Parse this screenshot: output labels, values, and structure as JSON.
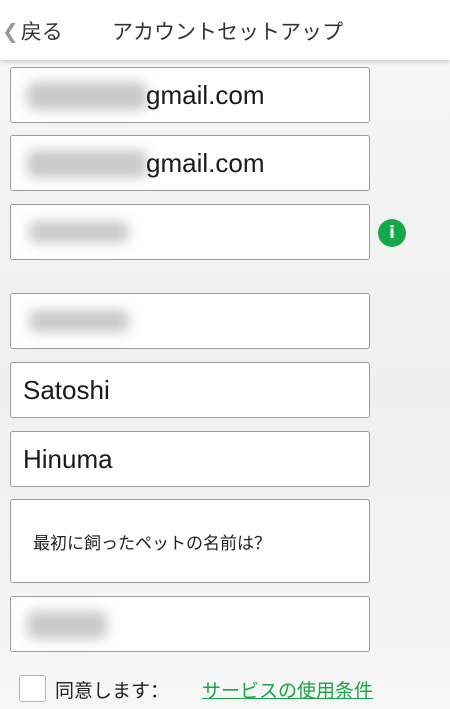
{
  "header": {
    "back_label": "戻る",
    "title": "アカウントセットアップ"
  },
  "form": {
    "email": "gmail.com",
    "email_confirm": "gmail.com",
    "first_name": "Satoshi",
    "last_name": "Hinuma",
    "security_question": "最初に飼ったペットの名前は？"
  },
  "info_icon_glyph": "i",
  "agreement": {
    "label": "同意します：",
    "link": "サービスの使用条件"
  },
  "colors": {
    "accent_green": "#1aa34a"
  }
}
